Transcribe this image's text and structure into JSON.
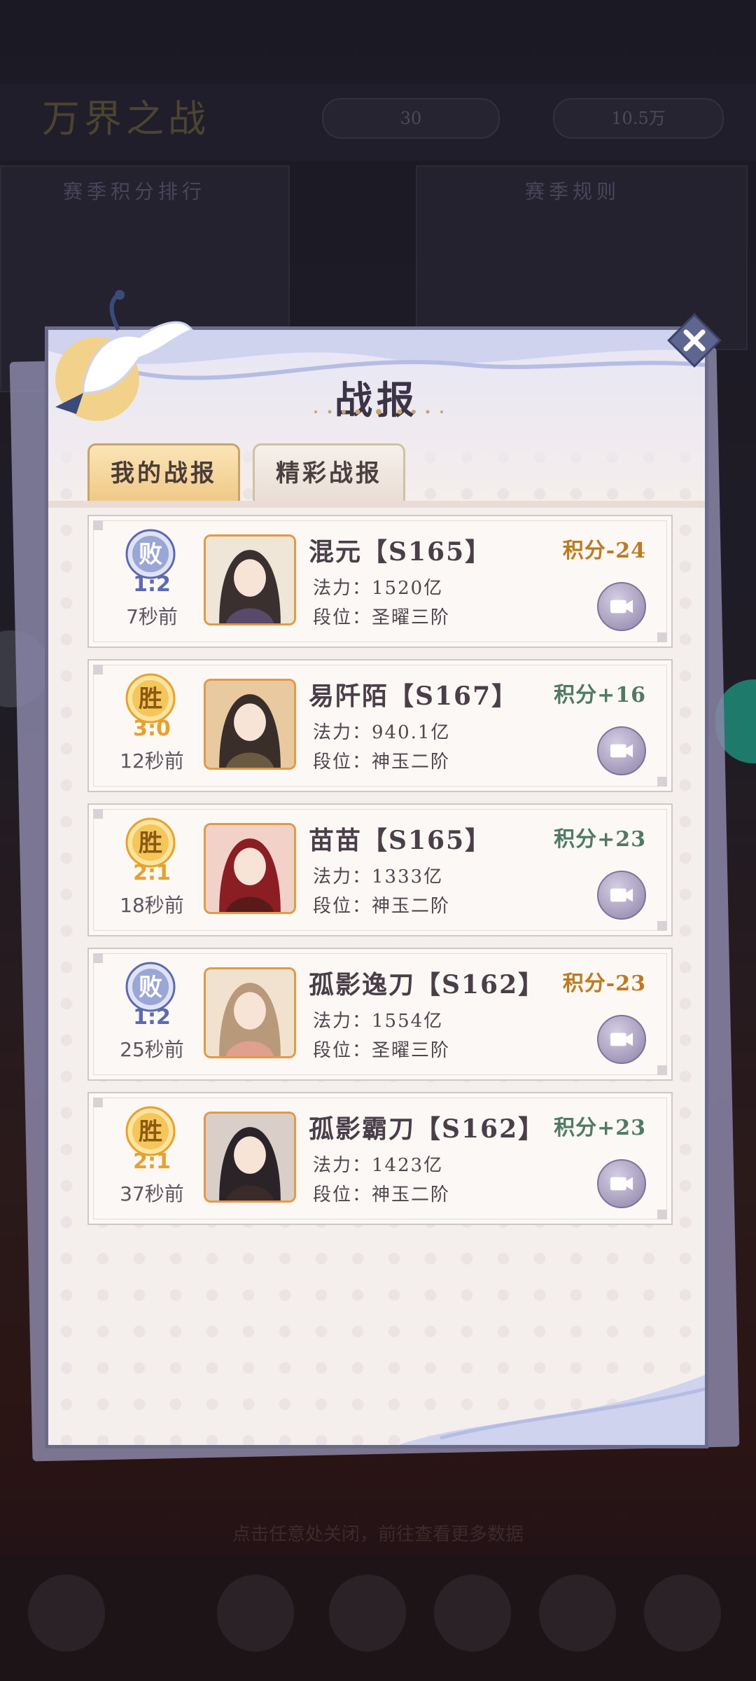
{
  "background": {
    "title": "万界之战",
    "resource_1": "30",
    "resource_2": "10.5万",
    "left_panel_title": "赛季积分排行",
    "right_panel_title": "赛季规则",
    "bottom_hint": "点击任意处关闭，前往查看更多数据"
  },
  "dialog": {
    "title": "战报",
    "tabs": [
      {
        "label": "我的战报",
        "active": true
      },
      {
        "label": "精彩战报",
        "active": false
      }
    ]
  },
  "records": [
    {
      "result": "败",
      "score": "1:2",
      "time": "7秒前",
      "name": "混元【S165】",
      "power": "法力：1520亿",
      "rank": "段位：圣曜三阶",
      "delta": "积分-24",
      "win": false
    },
    {
      "result": "胜",
      "score": "3:0",
      "time": "12秒前",
      "name": "易阡陌【S167】",
      "power": "法力：940.1亿",
      "rank": "段位：神玉二阶",
      "delta": "积分+16",
      "win": true
    },
    {
      "result": "胜",
      "score": "2:1",
      "time": "18秒前",
      "name": "苗苗【S165】",
      "power": "法力：1333亿",
      "rank": "段位：神玉二阶",
      "delta": "积分+23",
      "win": true
    },
    {
      "result": "败",
      "score": "1:2",
      "time": "25秒前",
      "name": "孤影逸刀【S162】",
      "power": "法力：1554亿",
      "rank": "段位：圣曜三阶",
      "delta": "积分-23",
      "win": false
    },
    {
      "result": "胜",
      "score": "2:1",
      "time": "37秒前",
      "name": "孤影霸刀【S162】",
      "power": "法力：1423亿",
      "rank": "段位：神玉二阶",
      "delta": "积分+23",
      "win": true
    }
  ],
  "colors": {
    "win": "#e8a12a",
    "lose": "#5a6bb0",
    "delta_win": "#4f7a64",
    "delta_lose": "#c07a1e"
  }
}
